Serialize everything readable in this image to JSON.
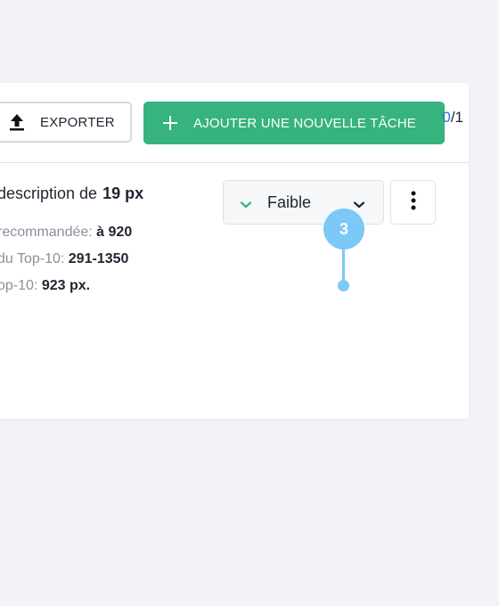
{
  "toolbar": {
    "export_label": "EXPORTER",
    "add_label": "AJOUTER UNE NOUVELLE TÂCHE",
    "accent_color": "#36b37e"
  },
  "counter": {
    "current": "0",
    "total": "/1"
  },
  "task": {
    "title": "description de",
    "title_value": "19 px",
    "metrics": [
      {
        "label": "recommandée: ",
        "value": "à 920"
      },
      {
        "label": "du Top-10: ",
        "value": "291-1350"
      },
      {
        "label": "op-10: ",
        "value": "923 px."
      }
    ]
  },
  "priority": {
    "label": "Faible",
    "icon": "chevron-down-icon"
  },
  "annotation": {
    "number": "3",
    "color": "#7cc8f7"
  }
}
